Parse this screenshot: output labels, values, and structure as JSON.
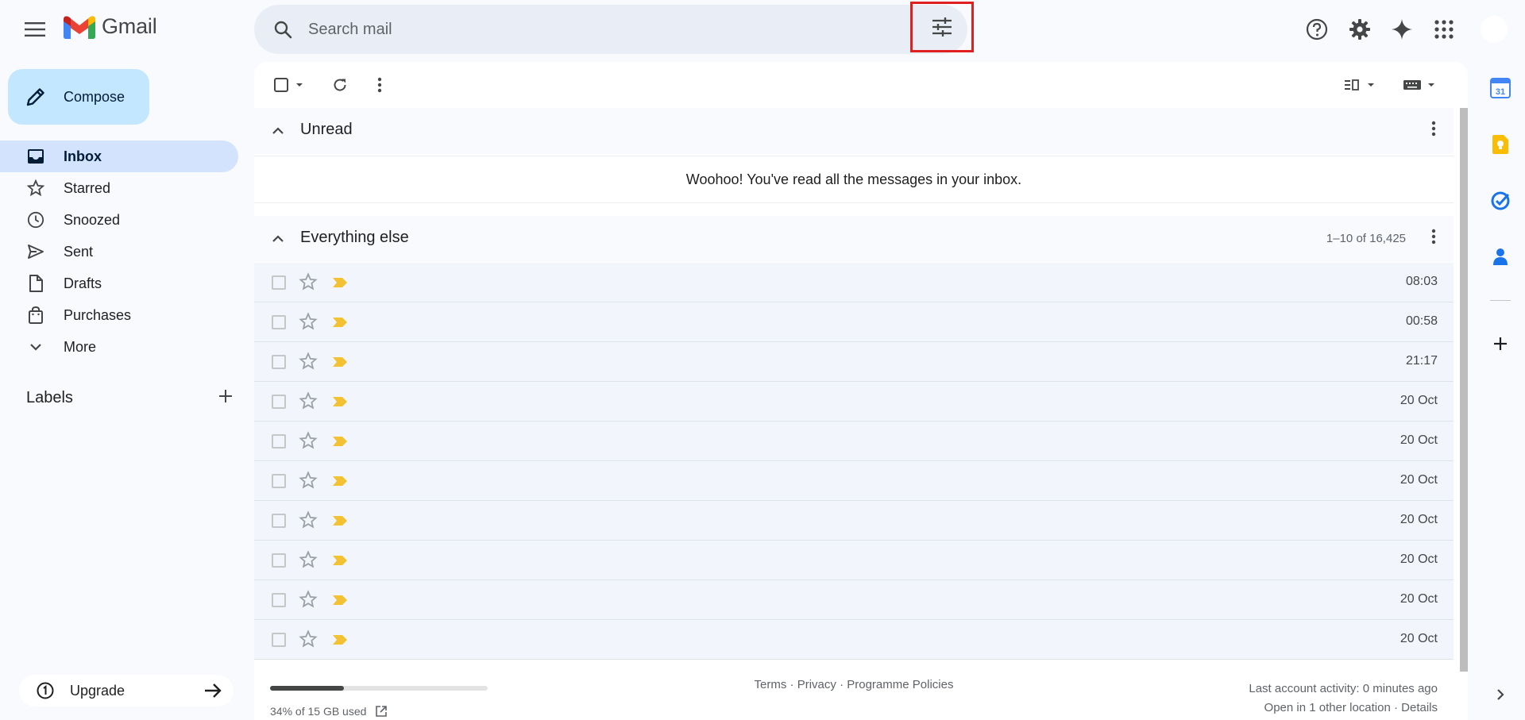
{
  "app": {
    "name": "Gmail"
  },
  "search": {
    "placeholder": "Search mail"
  },
  "compose": {
    "label": "Compose"
  },
  "nav": [
    {
      "id": "inbox",
      "label": "Inbox",
      "active": true
    },
    {
      "id": "starred",
      "label": "Starred"
    },
    {
      "id": "snoozed",
      "label": "Snoozed"
    },
    {
      "id": "sent",
      "label": "Sent"
    },
    {
      "id": "drafts",
      "label": "Drafts"
    },
    {
      "id": "purchases",
      "label": "Purchases"
    },
    {
      "id": "more",
      "label": "More"
    }
  ],
  "labels": {
    "title": "Labels"
  },
  "upgrade": {
    "label": "Upgrade"
  },
  "sections": {
    "unread": {
      "title": "Unread",
      "empty_message": "Woohoo! You've read all the messages in your inbox."
    },
    "everything_else": {
      "title": "Everything else",
      "count": "1–10 of 16,425"
    }
  },
  "emails": [
    {
      "time": "08:03"
    },
    {
      "time": "00:58"
    },
    {
      "time": "21:17"
    },
    {
      "time": "20 Oct"
    },
    {
      "time": "20 Oct"
    },
    {
      "time": "20 Oct"
    },
    {
      "time": "20 Oct"
    },
    {
      "time": "20 Oct"
    },
    {
      "time": "20 Oct"
    },
    {
      "time": "20 Oct"
    }
  ],
  "footer": {
    "storage_fraction": 0.34,
    "storage_text": "34% of 15 GB used",
    "terms": "Terms",
    "privacy": "Privacy",
    "policies": "Programme Policies",
    "last_activity": "Last account activity: 0 minutes ago",
    "other_location": "Open in 1 other location · Details"
  },
  "side_apps": [
    {
      "id": "calendar",
      "label": "31"
    },
    {
      "id": "keep"
    },
    {
      "id": "tasks"
    },
    {
      "id": "contacts"
    }
  ],
  "colors": {
    "accent": "#c2e7ff",
    "active_nav": "#d3e3fd",
    "importance": "#f2c232",
    "highlight_box": "#e02020"
  }
}
